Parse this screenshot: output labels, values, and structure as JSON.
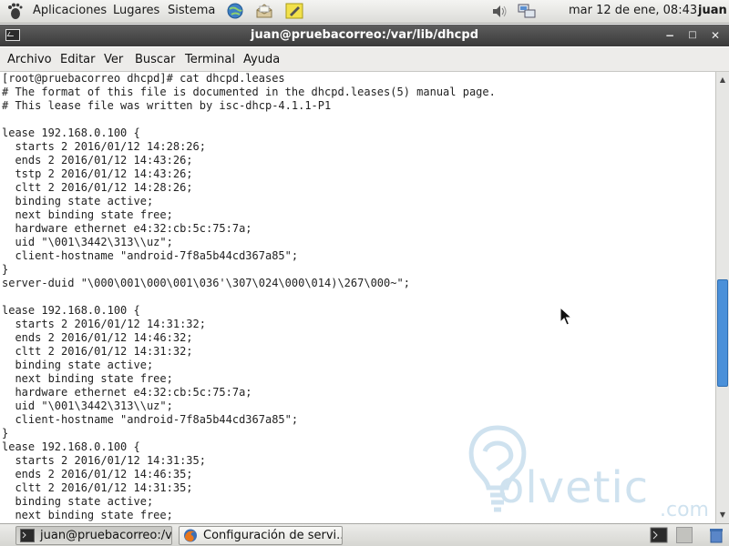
{
  "top_panel": {
    "menus": [
      "Aplicaciones",
      "Lugares",
      "Sistema"
    ],
    "clock": "mar 12 de ene, 08:43",
    "user": "juan"
  },
  "window": {
    "title": "juan@pruebacorreo:/var/lib/dhcpd",
    "buttons": [
      "−",
      "□",
      "✕"
    ]
  },
  "menubar": [
    "Archivo",
    "Editar",
    "Ver",
    "Buscar",
    "Terminal",
    "Ayuda"
  ],
  "terminal": {
    "lines": [
      "[root@pruebacorreo dhcpd]# cat dhcpd.leases",
      "# The format of this file is documented in the dhcpd.leases(5) manual page.",
      "# This lease file was written by isc-dhcp-4.1.1-P1",
      "",
      "lease 192.168.0.100 {",
      "  starts 2 2016/01/12 14:28:26;",
      "  ends 2 2016/01/12 14:43:26;",
      "  tstp 2 2016/01/12 14:43:26;",
      "  cltt 2 2016/01/12 14:28:26;",
      "  binding state active;",
      "  next binding state free;",
      "  hardware ethernet e4:32:cb:5c:75:7a;",
      "  uid \"\\001\\3442\\313\\\\uz\";",
      "  client-hostname \"android-7f8a5b44cd367a85\";",
      "}",
      "server-duid \"\\000\\001\\000\\001\\036'\\307\\024\\000\\014)\\267\\000~\";",
      "",
      "lease 192.168.0.100 {",
      "  starts 2 2016/01/12 14:31:32;",
      "  ends 2 2016/01/12 14:46:32;",
      "  cltt 2 2016/01/12 14:31:32;",
      "  binding state active;",
      "  next binding state free;",
      "  hardware ethernet e4:32:cb:5c:75:7a;",
      "  uid \"\\001\\3442\\313\\\\uz\";",
      "  client-hostname \"android-7f8a5b44cd367a85\";",
      "}",
      "lease 192.168.0.100 {",
      "  starts 2 2016/01/12 14:31:35;",
      "  ends 2 2016/01/12 14:46:35;",
      "  cltt 2 2016/01/12 14:31:35;",
      "  binding state active;",
      "  next binding state free;"
    ]
  },
  "scrollbar": {
    "up_arrow": "▲",
    "down_arrow": "▼"
  },
  "taskbar": {
    "tasks": [
      {
        "label": "juan@pruebacorreo:/v...",
        "icon": "terminal-icon"
      },
      {
        "label": "Configuración de servi...",
        "icon": "firefox-icon"
      }
    ]
  },
  "watermark": {
    "text": "olvetic",
    "suffix": ".com"
  },
  "colors": {
    "titlebar": "#4a4a4a",
    "scroll_thumb": "#4a90d9",
    "watermark": "#2a7fb8",
    "terminal_text": "#222222"
  }
}
